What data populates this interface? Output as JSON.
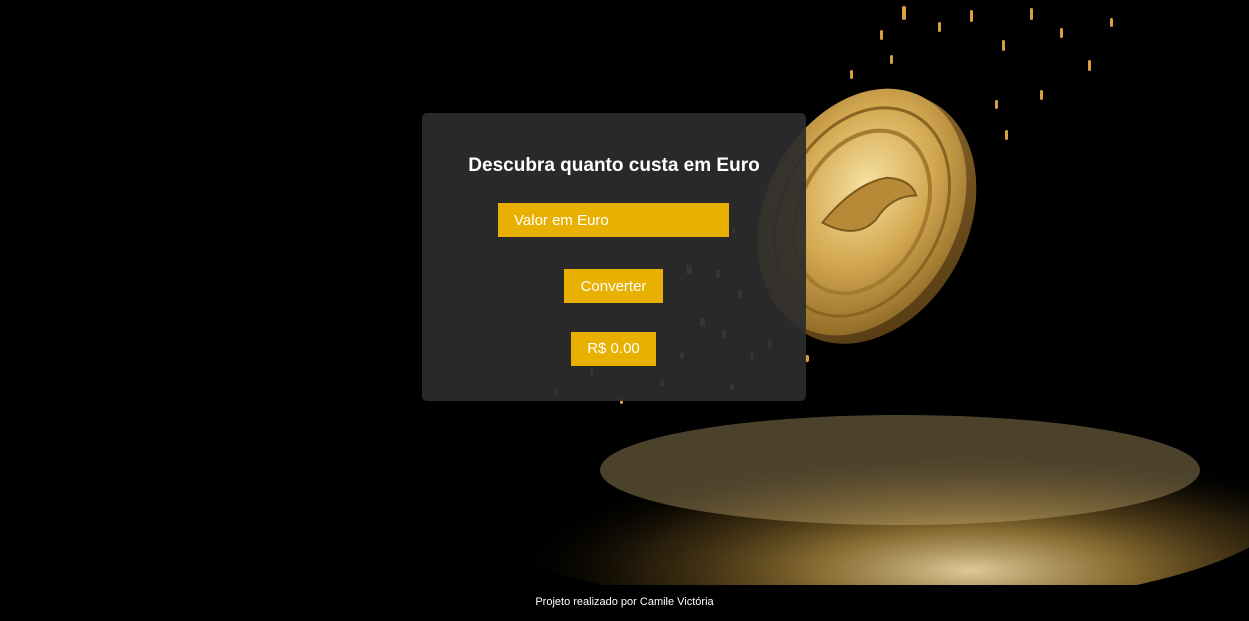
{
  "converter": {
    "title": "Descubra quanto custa em Euro",
    "input_placeholder": "Valor em Euro",
    "input_value": "",
    "convert_label": "Converter",
    "result_text": "R$ 0.00"
  },
  "footer": {
    "credit": "Projeto realizado por Camile Victória"
  },
  "background": {
    "image_subject": "gold-coin-falling-with-gold-sparks"
  },
  "colors": {
    "accent": "#e8b000",
    "card_background": "#2c2c2c",
    "page_background": "#000000",
    "text": "#ffffff"
  }
}
